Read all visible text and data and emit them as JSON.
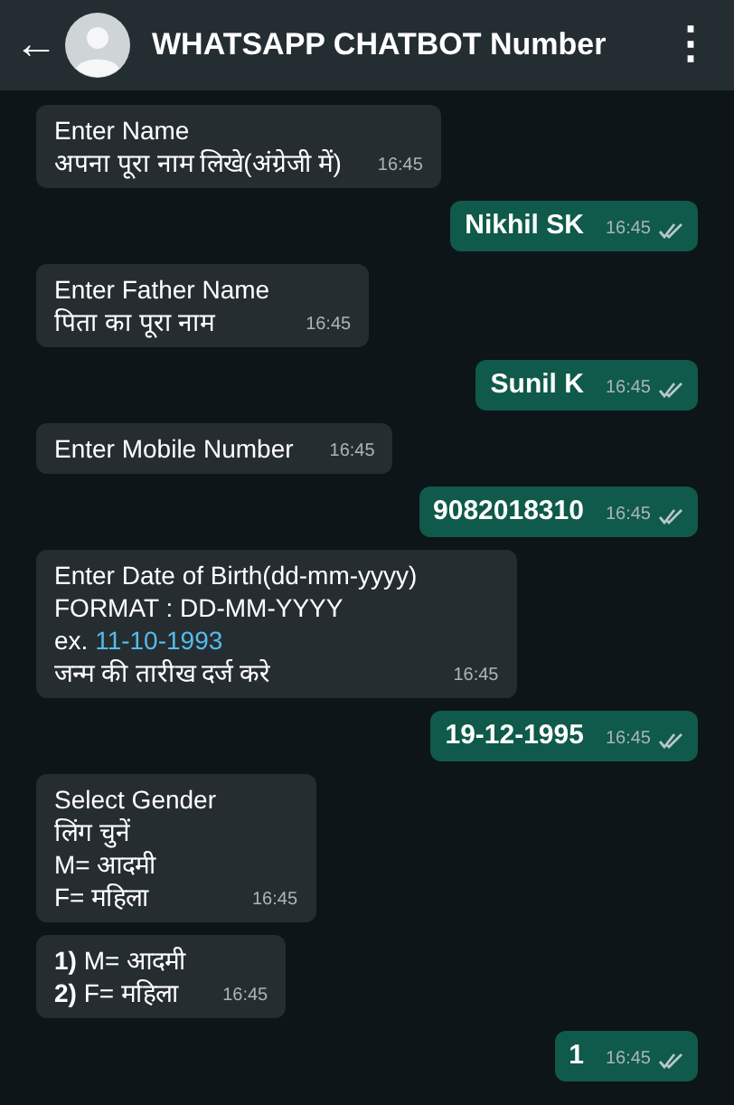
{
  "header": {
    "back": "←",
    "title": "WHATSAPP CHATBOT Number",
    "menu": "⋮"
  },
  "messages": [
    {
      "kind": "incoming",
      "lines": [
        {
          "text": "Enter Name"
        },
        {
          "text": "अपना पूरा नाम लिखे(अंग्रेजी में)"
        }
      ],
      "time": "16:45"
    },
    {
      "kind": "outgoing",
      "lines": [
        {
          "text": "Nikhil SK"
        }
      ],
      "time": "16:45",
      "read": false
    },
    {
      "kind": "incoming",
      "lines": [
        {
          "text": "Enter Father Name"
        },
        {
          "text": "पिता का पूरा नाम"
        }
      ],
      "time": "16:45"
    },
    {
      "kind": "outgoing",
      "lines": [
        {
          "text": "Sunil K"
        }
      ],
      "time": "16:45",
      "read": false
    },
    {
      "kind": "incoming",
      "lines": [
        {
          "text": "Enter Mobile Number"
        }
      ],
      "time": "16:45"
    },
    {
      "kind": "outgoing",
      "lines": [
        {
          "text": "9082018310"
        }
      ],
      "time": "16:45",
      "read": false
    },
    {
      "kind": "incoming",
      "lines": [
        {
          "text": "Enter Date of Birth(dd-mm-yyyy)"
        },
        {
          "text": "FORMAT : DD-MM-YYYY"
        },
        {
          "text": "ex.",
          "link": "11-10-1993"
        },
        {
          "text": "जन्म की तारीख दर्ज करे"
        }
      ],
      "time": "16:45"
    },
    {
      "kind": "outgoing",
      "lines": [
        {
          "text": "19-12-1995"
        }
      ],
      "time": "16:45",
      "read": false
    },
    {
      "kind": "incoming",
      "lines": [
        {
          "text": "Select Gender"
        },
        {
          "text": "लिंग चुनें"
        },
        {
          "text": "M= आदमी"
        },
        {
          "text": "F= महिला"
        }
      ],
      "time": "16:45"
    },
    {
      "kind": "incoming",
      "lines": [
        {
          "text": "**1)** M= आदमी"
        },
        {
          "text": "**2)** F= महिला"
        }
      ],
      "time": "16:45"
    },
    {
      "kind": "outgoing",
      "lines": [
        {
          "text": "1"
        }
      ],
      "time": "16:45",
      "read": false
    }
  ]
}
